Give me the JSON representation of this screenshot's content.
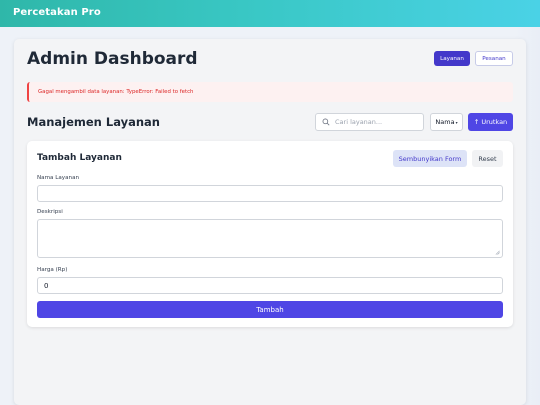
{
  "app": {
    "brand": "Percetakan Pro"
  },
  "header": {
    "title": "Admin Dashboard",
    "nav": [
      {
        "label": "Layanan",
        "active": true
      },
      {
        "label": "Pesanan",
        "active": false
      }
    ]
  },
  "alert": {
    "text": "Gagal mengambil data layanan: TypeError: Failed to fetch"
  },
  "section": {
    "title": "Manajemen Layanan",
    "search_placeholder": "Cari layanan...",
    "sort_field": "Nama",
    "sort_button": "↑ Urutkan"
  },
  "form": {
    "title": "Tambah Layanan",
    "hide_button": "Sembunyikan Form",
    "reset_button": "Reset",
    "fields": {
      "name_label": "Nama Layanan",
      "name_value": "",
      "desc_label": "Deskripsi",
      "desc_value": "",
      "price_label": "Harga (Rp)",
      "price_value": "0"
    },
    "submit_button": "Tambah"
  },
  "colors": {
    "accent": "#4f46e5",
    "accent_dark": "#4338ca",
    "header_gradient_start": "#2fb7a9",
    "header_gradient_end": "#4ad2e6",
    "error": "#dc2626"
  }
}
